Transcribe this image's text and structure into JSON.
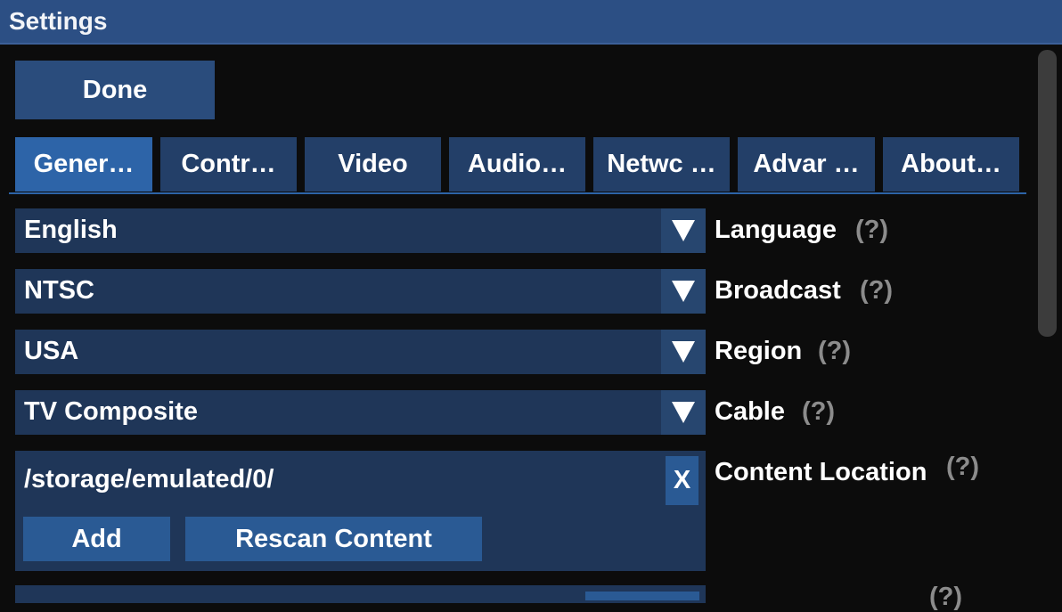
{
  "window": {
    "title": "Settings"
  },
  "toolbar": {
    "done_label": "Done"
  },
  "tabs": [
    {
      "label": "Gener…",
      "active": true
    },
    {
      "label": "Contr…",
      "active": false
    },
    {
      "label": "Video",
      "active": false
    },
    {
      "label": "Audio…",
      "active": false
    },
    {
      "label": "Netwc …",
      "active": false
    },
    {
      "label": "Advar …",
      "active": false
    },
    {
      "label": "About…",
      "active": false
    }
  ],
  "settings": [
    {
      "value": "English",
      "label": "Language",
      "help": "(?)"
    },
    {
      "value": "NTSC",
      "label": "Broadcast",
      "help": "(?)"
    },
    {
      "value": "USA",
      "label": "Region",
      "help": "(?)"
    },
    {
      "value": "TV Composite",
      "label": "Cable",
      "help": "(?)"
    }
  ],
  "content_location": {
    "path": "/storage/emulated/0/",
    "remove_label": "X",
    "add_label": "Add",
    "rescan_label": "Rescan Content",
    "label": "Content Location",
    "help": "(?)"
  },
  "next_row": {
    "help": "(?)"
  },
  "colors": {
    "titlebar": "#2c4f84",
    "tab_active": "#2d64a8",
    "tab_inactive": "#233f68",
    "field_bg": "#1f3658",
    "button_bg": "#2a5a94",
    "help_text": "#8c8c8c",
    "background": "#0c0c0c"
  },
  "icons": {
    "dropdown": "triangle-down-icon"
  }
}
